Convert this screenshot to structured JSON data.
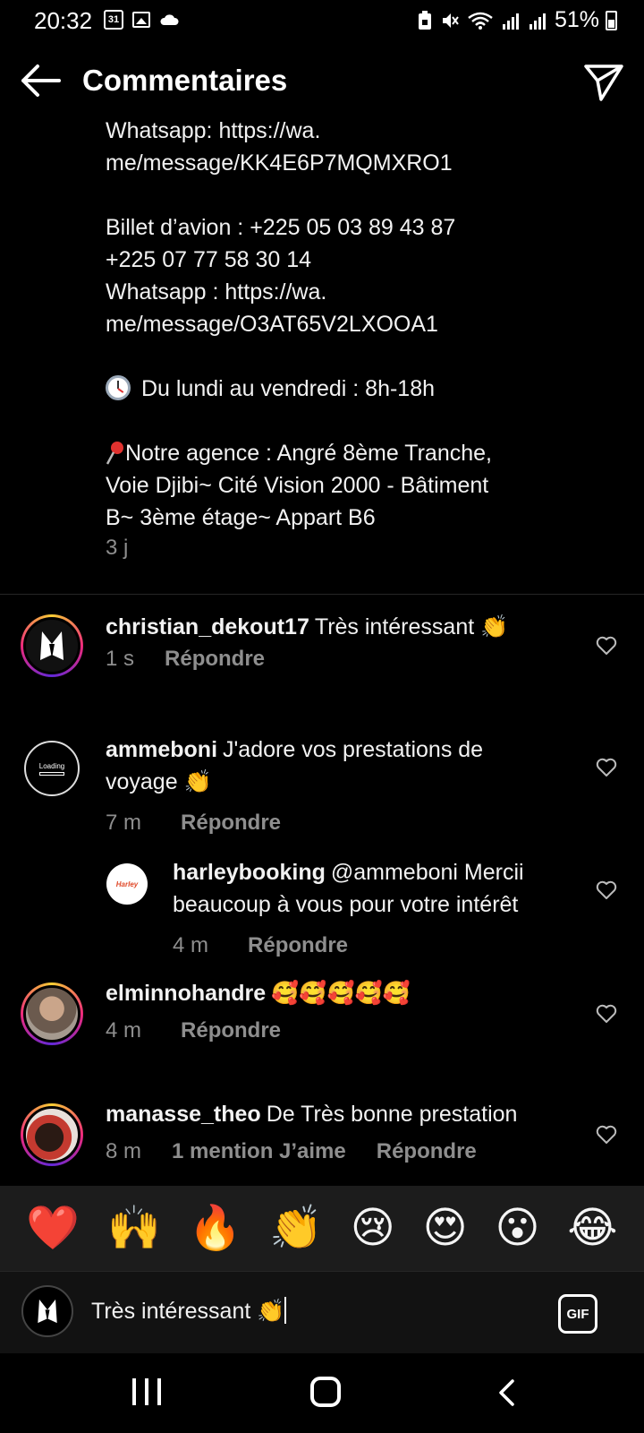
{
  "status_bar": {
    "time": "20:32",
    "calendar_day": "31",
    "battery_text": "51%"
  },
  "header": {
    "title": "Commentaires"
  },
  "caption": {
    "lines": [
      "Whatsapp: https://wa.",
      "me/message/KK4E6P7MQMXRO1",
      "",
      "Billet d’avion : +225 05 03 89 43 87",
      "+225 07 77 58 30 14",
      "Whatsapp : https://wa.",
      "me/message/O3AT65V2LXOOA1",
      "",
      "Du lundi au vendredi : 8h-18h",
      "",
      "Notre agence : Angré 8ème Tranche,",
      "Voie Djibi~ Cité Vision 2000 - Bâtiment",
      "B~ 3ème étage~ Appart B6"
    ],
    "time": "3 j"
  },
  "comments": [
    {
      "user": "christian_dekout17",
      "text": "Très intéressant 👏",
      "time": "1 s",
      "reply": "Répondre"
    },
    {
      "user": "ammeboni",
      "text_line1": "J'adore vos prestations de",
      "text_line2": "voyage 👏",
      "time": "7 m",
      "reply": "Répondre",
      "avatar_text": "Loading"
    },
    {
      "user": "harleybooking",
      "text_line1": "@ammeboni Mercii",
      "text_line2": "beaucoup à vous pour votre intérêt",
      "time": "4 m",
      "reply": "Répondre",
      "avatar_text": "Harley"
    },
    {
      "user": "elminnohandre",
      "text": "🥰🥰🥰🥰🥰",
      "time": "4 m",
      "reply": "Répondre"
    },
    {
      "user": "manasse_theo",
      "text": "De Très bonne prestation",
      "time": "8 m",
      "likes": "1 mention J’aime",
      "reply": "Répondre"
    }
  ],
  "emoji_bar": [
    "❤️",
    "🙌",
    "🔥",
    "👏",
    "😢",
    "😍",
    "😮",
    "😂"
  ],
  "composer": {
    "value": "Très intéressant 👏",
    "gif_label": "GIF"
  }
}
